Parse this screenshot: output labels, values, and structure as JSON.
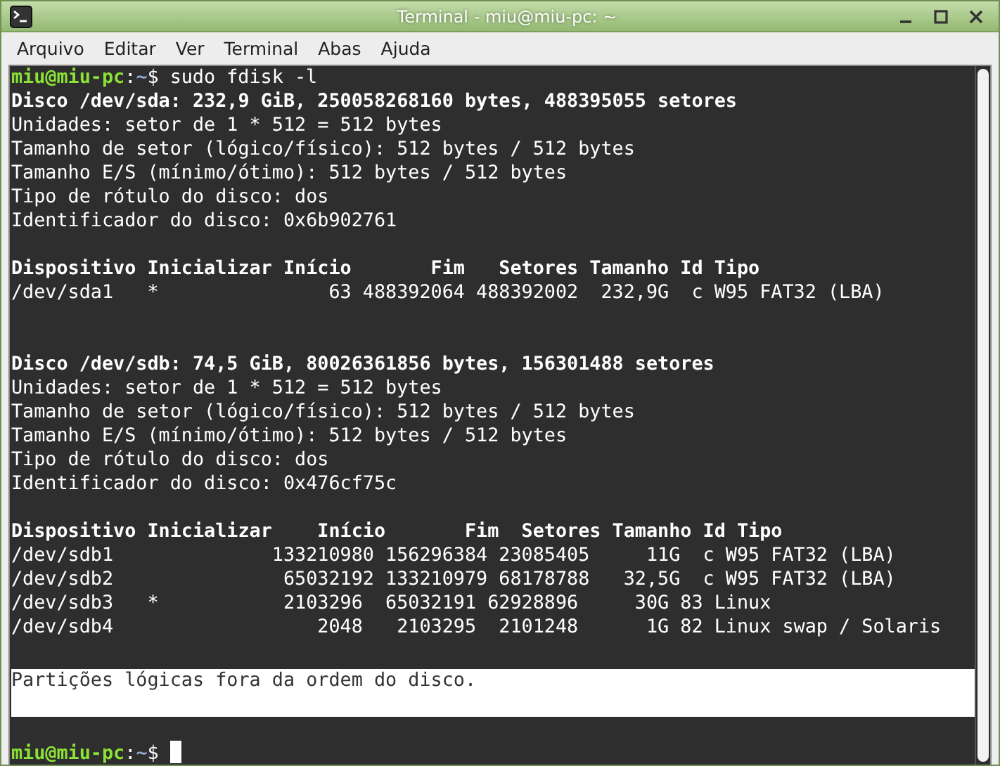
{
  "window": {
    "title": "Terminal - miu@miu-pc: ~"
  },
  "menu": [
    "Arquivo",
    "Editar",
    "Ver",
    "Terminal",
    "Abas",
    "Ajuda"
  ],
  "lines": [
    {
      "kind": "prompt",
      "user": "miu@miu-pc",
      "separator": ":",
      "path": "~",
      "symbol": "$",
      "command": "sudo fdisk -l",
      "cursor": false
    },
    {
      "kind": "bold",
      "text": "Disco /dev/sda: 232,9 GiB, 250058268160 bytes, 488395055 setores"
    },
    {
      "kind": "normal",
      "text": "Unidades: setor de 1 * 512 = 512 bytes"
    },
    {
      "kind": "normal",
      "text": "Tamanho de setor (lógico/físico): 512 bytes / 512 bytes"
    },
    {
      "kind": "normal",
      "text": "Tamanho E/S (mínimo/ótimo): 512 bytes / 512 bytes"
    },
    {
      "kind": "normal",
      "text": "Tipo de rótulo do disco: dos"
    },
    {
      "kind": "normal",
      "text": "Identificador do disco: 0x6b902761"
    },
    {
      "kind": "blank"
    },
    {
      "kind": "bold",
      "text": "Dispositivo Inicializar Início       Fim   Setores Tamanho Id Tipo"
    },
    {
      "kind": "normal",
      "text": "/dev/sda1   *               63 488392064 488392002  232,9G  c W95 FAT32 (LBA)"
    },
    {
      "kind": "blank"
    },
    {
      "kind": "blank"
    },
    {
      "kind": "bold",
      "text": "Disco /dev/sdb: 74,5 GiB, 80026361856 bytes, 156301488 setores"
    },
    {
      "kind": "normal",
      "text": "Unidades: setor de 1 * 512 = 512 bytes"
    },
    {
      "kind": "normal",
      "text": "Tamanho de setor (lógico/físico): 512 bytes / 512 bytes"
    },
    {
      "kind": "normal",
      "text": "Tamanho E/S (mínimo/ótimo): 512 bytes / 512 bytes"
    },
    {
      "kind": "normal",
      "text": "Tipo de rótulo do disco: dos"
    },
    {
      "kind": "normal",
      "text": "Identificador do disco: 0x476cf75c"
    },
    {
      "kind": "blank"
    },
    {
      "kind": "bold",
      "text": "Dispositivo Inicializar    Início       Fim  Setores Tamanho Id Tipo"
    },
    {
      "kind": "normal",
      "text": "/dev/sdb1              133210980 156296384 23085405     11G  c W95 FAT32 (LBA)"
    },
    {
      "kind": "normal",
      "text": "/dev/sdb2               65032192 133210979 68178788   32,5G  c W95 FAT32 (LBA)"
    },
    {
      "kind": "normal",
      "text": "/dev/sdb3   *           2103296  65032191 62928896     30G 83 Linux"
    },
    {
      "kind": "normal",
      "text": "/dev/sdb4                  2048   2103295  2101248      1G 82 Linux swap / Solaris"
    },
    {
      "kind": "blank"
    },
    {
      "kind": "highlight",
      "text": "Partições lógicas fora da ordem do disco."
    },
    {
      "kind": "blank"
    },
    {
      "kind": "prompt",
      "user": "miu@miu-pc",
      "separator": ":",
      "path": "~",
      "symbol": "$",
      "cursor": true
    }
  ]
}
